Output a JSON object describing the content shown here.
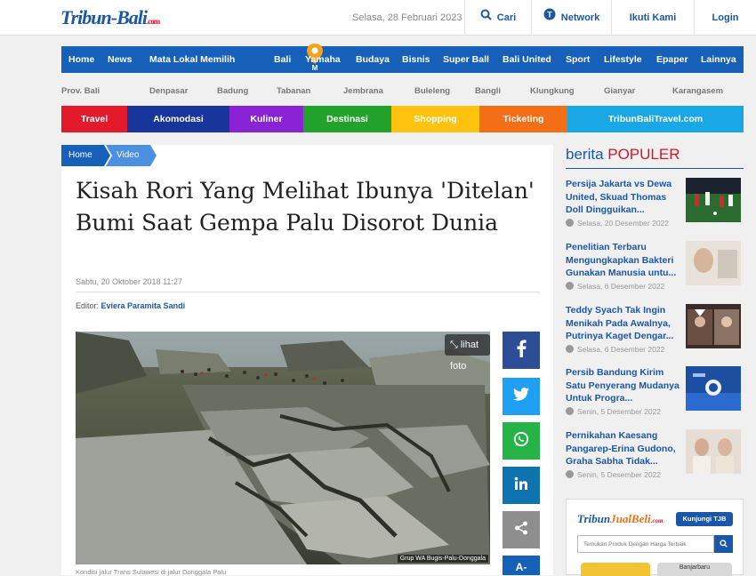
{
  "header": {
    "logo_text": "Tribun-Bali",
    "logo_suffix": ".com",
    "date": "Selasa, 28 Februari 2023",
    "search_label": "Cari",
    "network_label": "Network",
    "follow_label": "Ikuti Kami",
    "login_label": "Login"
  },
  "nav": {
    "items": [
      "Home",
      "News",
      "Mata Lokal Memilih",
      "Bali",
      "Yamaha",
      "Budaya",
      "Bisnis",
      "Super Ball",
      "Bali United",
      "Sport",
      "Lifestyle",
      "Epaper",
      "Lainnya"
    ]
  },
  "regions": [
    "Prov. Bali",
    "Denpasar",
    "Badung",
    "Tabanan",
    "Jembrana",
    "Buleleng",
    "Bangli",
    "Klungkung",
    "Gianyar",
    "Karangasem"
  ],
  "colorbar": {
    "items": [
      {
        "label": "Travel",
        "color": "#e3192c"
      },
      {
        "label": "Akomodasi",
        "color": "#17359a"
      },
      {
        "label": "Kuliner",
        "color": "#8a22d6"
      },
      {
        "label": "Destinasi",
        "color": "#23a22b"
      },
      {
        "label": "Shopping",
        "color": "#ffc20e"
      },
      {
        "label": "Ticketing",
        "color": "#f36f17"
      },
      {
        "label": "TribunBaliTravel.com",
        "color": "#19a8e5"
      }
    ]
  },
  "article": {
    "breadcrumb": [
      "Home",
      "Video"
    ],
    "title": "Kisah Rori Yang Melihat Ibunya 'Ditelan' Bumi Saat Gempa Palu Disorot Dunia",
    "published": "Sabtu, 20 Oktober 2018 11:27",
    "editor_prefix": "Editor: ",
    "editor_name": "Eviera Paramita Sandi",
    "photo_button": "lihat foto",
    "photo_credit": "Grup WA Bugis-Palu-Donggala",
    "caption": "Kondisi jalur Trans Sulawesi di jalur Donggala Palu"
  },
  "share": {
    "buttons": [
      {
        "name": "facebook",
        "color": "#2d4e97"
      },
      {
        "name": "twitter",
        "color": "#1fa0f2"
      },
      {
        "name": "whatsapp",
        "color": "#26b347"
      },
      {
        "name": "linkedin",
        "color": "#0e73af"
      },
      {
        "name": "share",
        "color": "#8e8e8e"
      },
      {
        "name": "font-size",
        "color": "#1760b9"
      }
    ],
    "font_label": "A-"
  },
  "sidebar": {
    "heading_prefix": "berita ",
    "heading_highlight": "POPULER",
    "popular": [
      {
        "title": "Persija Jakarta vs Dewa United, Skuad Thomas Doll Dingguikan...",
        "date": "Selasa, 20 Desember 2022"
      },
      {
        "title": "Penelitian Terbaru Mengungkapkan Bakteri Gunakan Manusia untu...",
        "date": "Selasa, 6 Desember 2022"
      },
      {
        "title": "Teddy Syach Tak Ingin Menikah Pada Awalnya, Putrinya Kaget Dengar...",
        "date": "Selasa, 6 Desember 2022"
      },
      {
        "title": "Persib Bandung Kirim Satu Penyerang Mudanya Untuk Progra...",
        "date": "Senin, 5 Desember 2022"
      },
      {
        "title": "Pernikahan Kaesang Pangarep-Erina Gudono, Graha Sabha Tidak...",
        "date": "Senin, 5 Desember 2022"
      }
    ]
  },
  "tjb": {
    "logo_prefix": "Tribun",
    "logo_highlight": "JualBeli",
    "logo_suffix": ".com",
    "button": "Kunjungi TJB",
    "placeholder": "Temukan Produk Dengan Harga Terbaik",
    "card_label": "Banjarbaru"
  }
}
